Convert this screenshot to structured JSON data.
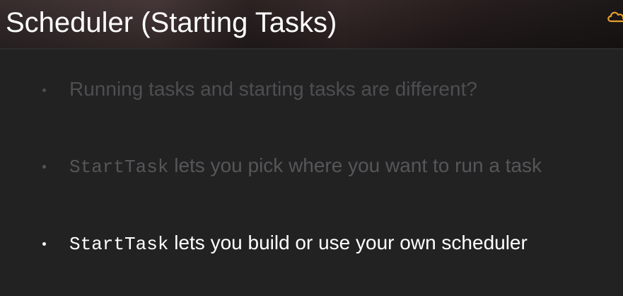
{
  "title": "Scheduler (Starting Tasks)",
  "header": {
    "icon": "cloud-icon",
    "icon_color": "#e8a030"
  },
  "bullets": [
    {
      "code": "",
      "text": "Running tasks and starting tasks are different?",
      "color": "#4e4e52"
    },
    {
      "code": "StartTask",
      "text": " lets you pick where you want to run a task",
      "color": "#56565a"
    },
    {
      "code": "StartTask",
      "text": " lets you build or use your own scheduler",
      "color": "#ffffff"
    }
  ]
}
